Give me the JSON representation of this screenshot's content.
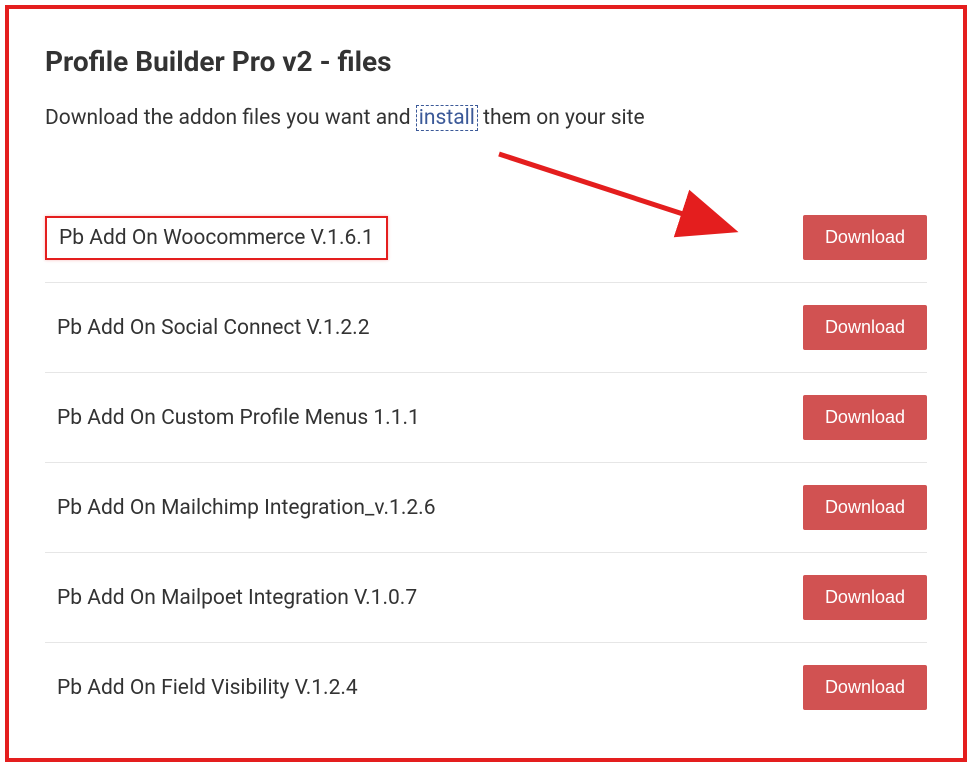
{
  "title": "Profile Builder Pro v2 - files",
  "description_before": "Download the addon files you want and ",
  "description_link": "install",
  "description_after": " them on your site",
  "download_label": "Download",
  "addons": [
    {
      "name": "Pb Add On Woocommerce V.1.6.1",
      "highlighted": true
    },
    {
      "name": "Pb Add On Social Connect V.1.2.2",
      "highlighted": false
    },
    {
      "name": "Pb Add On Custom Profile Menus 1.1.1",
      "highlighted": false
    },
    {
      "name": "Pb Add On Mailchimp Integration_v.1.2.6",
      "highlighted": false
    },
    {
      "name": "Pb Add On Mailpoet Integration V.1.0.7",
      "highlighted": false
    },
    {
      "name": "Pb Add On Field Visibility V.1.2.4",
      "highlighted": false
    }
  ],
  "colors": {
    "accent": "#e41e1e",
    "button": "#d15252",
    "link": "#3b5998"
  }
}
